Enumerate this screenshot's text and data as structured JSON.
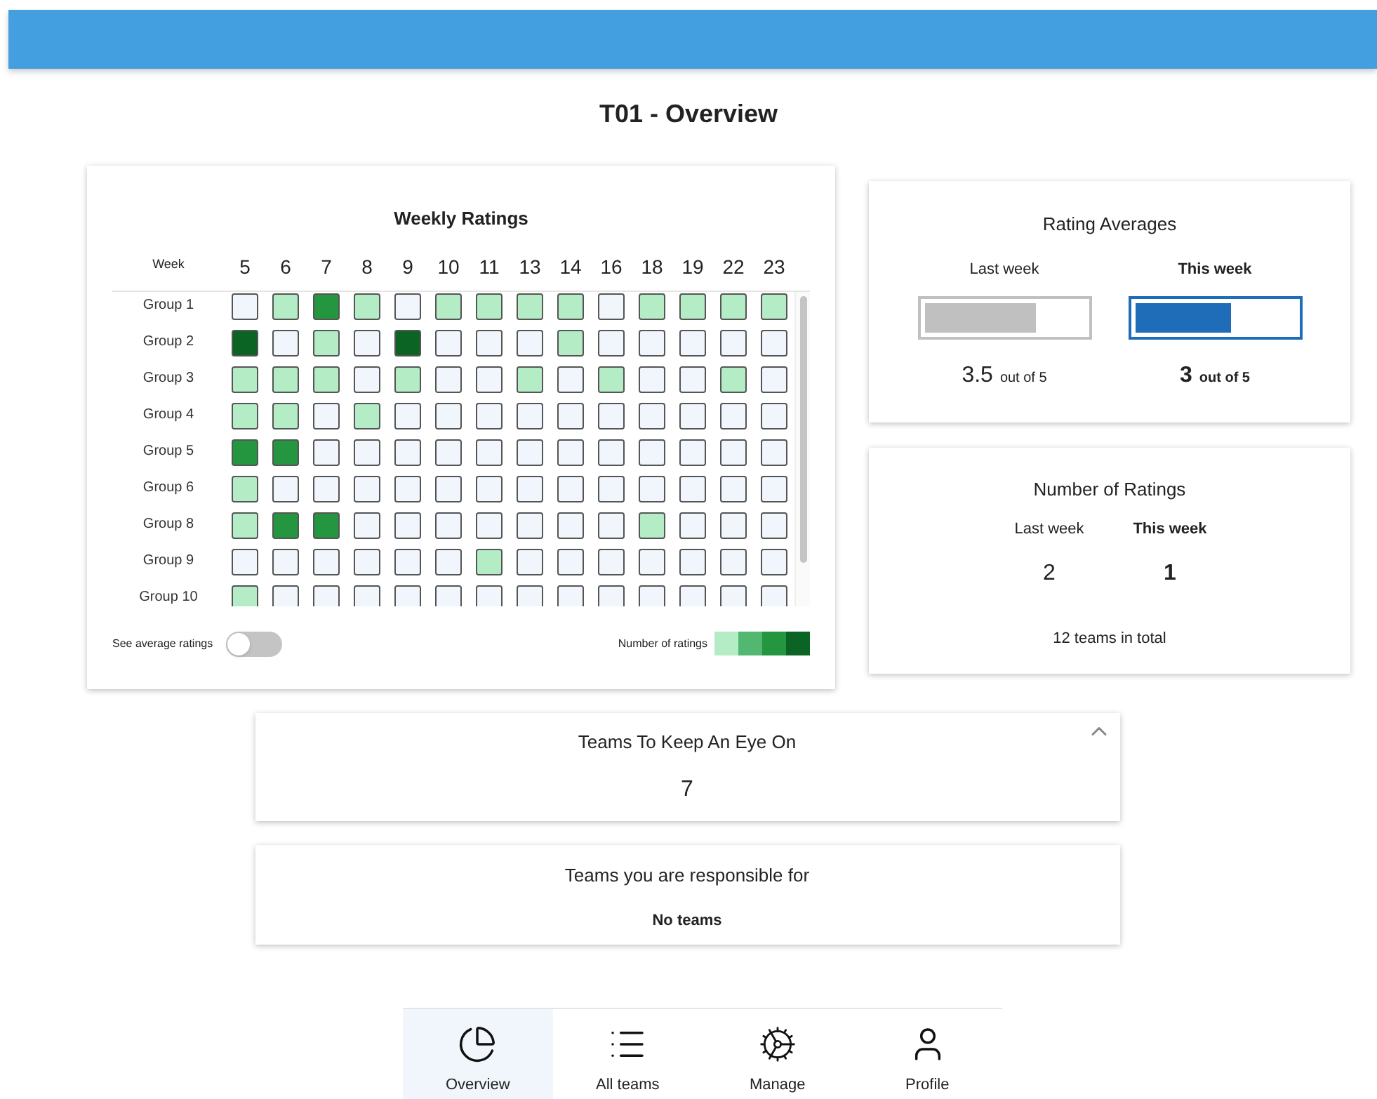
{
  "page": {
    "title": "T01 - Overview"
  },
  "weekly_ratings": {
    "title": "Weekly Ratings",
    "week_label": "Week",
    "weeks": [
      "5",
      "6",
      "7",
      "8",
      "9",
      "10",
      "11",
      "13",
      "14",
      "16",
      "18",
      "19",
      "22",
      "23"
    ],
    "groups": [
      {
        "name": "Group 1",
        "cells": [
          {
            "color": "#f1f6fd"
          },
          {
            "color": "#b4ecc6"
          },
          {
            "color": "#24963f"
          },
          {
            "color": "#b4ecc6"
          },
          {
            "color": "#f1f6fd"
          },
          {
            "color": "#b4ecc6"
          },
          {
            "color": "#b4ecc6"
          },
          {
            "color": "#b4ecc6"
          },
          {
            "color": "#b4ecc6"
          },
          {
            "color": "#f1f6fd"
          },
          {
            "color": "#b4ecc6"
          },
          {
            "color": "#b4ecc6"
          },
          {
            "color": "#b4ecc6"
          },
          {
            "color": "#b4ecc6"
          }
        ]
      },
      {
        "name": "Group 2",
        "cells": [
          {
            "color": "#0c6424"
          },
          {
            "color": "#f1f6fd"
          },
          {
            "color": "#b4ecc6"
          },
          {
            "color": "#f1f6fd"
          },
          {
            "color": "#0c6424"
          },
          {
            "color": "#f1f6fd"
          },
          {
            "color": "#f1f6fd"
          },
          {
            "color": "#f1f6fd"
          },
          {
            "color": "#b4ecc6"
          },
          {
            "color": "#f1f6fd"
          },
          {
            "color": "#f1f6fd"
          },
          {
            "color": "#f1f6fd"
          },
          {
            "color": "#f1f6fd"
          },
          {
            "color": "#f1f6fd"
          }
        ]
      },
      {
        "name": "Group 3",
        "cells": [
          {
            "color": "#b4ecc6"
          },
          {
            "color": "#b4ecc6"
          },
          {
            "color": "#b4ecc6"
          },
          {
            "color": "#f1f6fd"
          },
          {
            "color": "#b4ecc6"
          },
          {
            "color": "#f1f6fd"
          },
          {
            "color": "#f1f6fd"
          },
          {
            "color": "#b4ecc6"
          },
          {
            "color": "#f1f6fd"
          },
          {
            "color": "#b4ecc6"
          },
          {
            "color": "#f1f6fd"
          },
          {
            "color": "#f1f6fd"
          },
          {
            "color": "#b4ecc6"
          },
          {
            "color": "#f1f6fd"
          }
        ]
      },
      {
        "name": "Group 4",
        "cells": [
          {
            "color": "#b4ecc6"
          },
          {
            "color": "#b4ecc6"
          },
          {
            "color": "#f1f6fd"
          },
          {
            "color": "#b4ecc6"
          },
          {
            "color": "#f1f6fd"
          },
          {
            "color": "#f1f6fd"
          },
          {
            "color": "#f1f6fd"
          },
          {
            "color": "#f1f6fd"
          },
          {
            "color": "#f1f6fd"
          },
          {
            "color": "#f1f6fd"
          },
          {
            "color": "#f1f6fd"
          },
          {
            "color": "#f1f6fd"
          },
          {
            "color": "#f1f6fd"
          },
          {
            "color": "#f1f6fd"
          }
        ]
      },
      {
        "name": "Group 5",
        "cells": [
          {
            "color": "#24963f"
          },
          {
            "color": "#24963f"
          },
          {
            "color": "#f1f6fd"
          },
          {
            "color": "#f1f6fd"
          },
          {
            "color": "#f1f6fd"
          },
          {
            "color": "#f1f6fd"
          },
          {
            "color": "#f1f6fd"
          },
          {
            "color": "#f1f6fd"
          },
          {
            "color": "#f1f6fd"
          },
          {
            "color": "#f1f6fd"
          },
          {
            "color": "#f1f6fd"
          },
          {
            "color": "#f1f6fd"
          },
          {
            "color": "#f1f6fd"
          },
          {
            "color": "#f1f6fd"
          }
        ]
      },
      {
        "name": "Group 6",
        "cells": [
          {
            "color": "#b4ecc6"
          },
          {
            "color": "#f1f6fd"
          },
          {
            "color": "#f1f6fd"
          },
          {
            "color": "#f1f6fd"
          },
          {
            "color": "#f1f6fd"
          },
          {
            "color": "#f1f6fd"
          },
          {
            "color": "#f1f6fd"
          },
          {
            "color": "#f1f6fd"
          },
          {
            "color": "#f1f6fd"
          },
          {
            "color": "#f1f6fd"
          },
          {
            "color": "#f1f6fd"
          },
          {
            "color": "#f1f6fd"
          },
          {
            "color": "#f1f6fd"
          },
          {
            "color": "#f1f6fd"
          }
        ]
      },
      {
        "name": "Group 8",
        "cells": [
          {
            "color": "#b4ecc6"
          },
          {
            "color": "#24963f"
          },
          {
            "color": "#24963f"
          },
          {
            "color": "#f1f6fd"
          },
          {
            "color": "#f1f6fd"
          },
          {
            "color": "#f1f6fd"
          },
          {
            "color": "#f1f6fd"
          },
          {
            "color": "#f1f6fd"
          },
          {
            "color": "#f1f6fd"
          },
          {
            "color": "#f1f6fd"
          },
          {
            "color": "#b4ecc6"
          },
          {
            "color": "#f1f6fd"
          },
          {
            "color": "#f1f6fd"
          },
          {
            "color": "#f1f6fd"
          }
        ]
      },
      {
        "name": "Group 9",
        "cells": [
          {
            "color": "#f1f6fd"
          },
          {
            "color": "#f1f6fd"
          },
          {
            "color": "#f1f6fd"
          },
          {
            "color": "#f1f6fd"
          },
          {
            "color": "#f1f6fd"
          },
          {
            "color": "#f1f6fd"
          },
          {
            "color": "#b4ecc6"
          },
          {
            "color": "#f1f6fd"
          },
          {
            "color": "#f1f6fd"
          },
          {
            "color": "#f1f6fd"
          },
          {
            "color": "#f1f6fd"
          },
          {
            "color": "#f1f6fd"
          },
          {
            "color": "#f1f6fd"
          },
          {
            "color": "#f1f6fd"
          }
        ]
      },
      {
        "name": "Group 10",
        "cells": [
          {
            "color": "#b4ecc6"
          },
          {
            "color": "#f1f6fd"
          },
          {
            "color": "#f1f6fd"
          },
          {
            "color": "#f1f6fd"
          },
          {
            "color": "#f1f6fd"
          },
          {
            "color": "#f1f6fd"
          },
          {
            "color": "#f1f6fd"
          },
          {
            "color": "#f1f6fd"
          },
          {
            "color": "#f1f6fd"
          },
          {
            "color": "#f1f6fd"
          },
          {
            "color": "#f1f6fd"
          },
          {
            "color": "#f1f6fd"
          },
          {
            "color": "#f1f6fd"
          },
          {
            "color": "#f1f6fd"
          }
        ]
      }
    ],
    "toggle": {
      "label": "See average ratings",
      "on": false
    },
    "legend": {
      "label": "Number of ratings",
      "swatches": [
        {
          "color": "#b4ecc6"
        },
        {
          "color": "#52b871"
        },
        {
          "color": "#24963f"
        },
        {
          "color": "#0c6424"
        }
      ]
    }
  },
  "rating_averages": {
    "title": "Rating Averages",
    "columns": [
      {
        "label": "Last week",
        "kind": "previous",
        "level": 0.7,
        "value": "3.5",
        "suffix": "out of 5"
      },
      {
        "label": "This week",
        "kind": "current",
        "level": 0.6,
        "value": "3",
        "suffix": "out of 5"
      }
    ]
  },
  "number_of_ratings": {
    "title": "Number of Ratings",
    "columns": [
      {
        "label": "Last week",
        "kind": "previous",
        "value": "2"
      },
      {
        "label": "This week",
        "kind": "current",
        "value": "1"
      }
    ],
    "total": "12 teams in total"
  },
  "teams_to_watch": {
    "title": "Teams To Keep An Eye On",
    "count": "7",
    "expanded": true
  },
  "responsible_teams": {
    "title": "Teams you are responsible for",
    "message": "No teams"
  },
  "nav": [
    {
      "label": "Overview",
      "selected": true
    },
    {
      "label": "All teams",
      "selected": false
    },
    {
      "label": "Manage",
      "selected": false
    },
    {
      "label": "Profile",
      "selected": false
    }
  ]
}
